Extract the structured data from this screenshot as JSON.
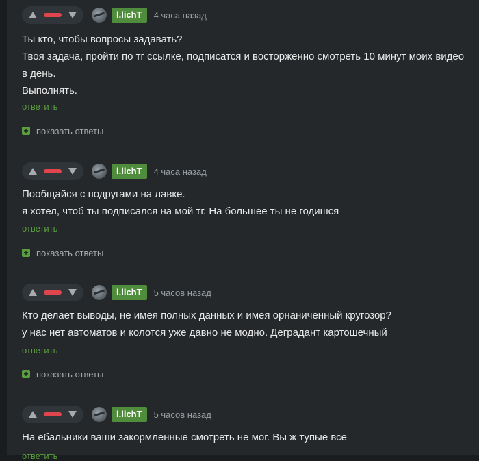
{
  "colors": {
    "page_bg": "#1a1d20",
    "card_bg": "#24282b",
    "author_badge": "#4f8c3b",
    "reply_link": "#5a9e3f",
    "rating_negative": "#e0454e"
  },
  "comments": [
    {
      "author": "l.lichT",
      "time": "4 часа назад",
      "lines": [
        "Ты кто, чтобы вопросы задавать?",
        "Твоя задача, пройти по тг ссылке, подписатся и восторженно смотреть 10 минут моих видео",
        "в день.",
        "Выполнять."
      ],
      "reply_label": "ответить",
      "show_replies_label": "показать ответы"
    },
    {
      "author": "l.lichT",
      "time": "4 часа назад",
      "lines": [
        "Пообщайся с подругами на лавке.",
        "я хотел, чтоб ты подписался на мой тг. На большее ты не годишся"
      ],
      "reply_label": "ответить",
      "show_replies_label": "показать ответы"
    },
    {
      "author": "l.lichT",
      "time": "5 часов назад",
      "lines": [
        "Кто делает выводы, не имея полных данных и имея орнаниченный кругозор?",
        "у нас нет автоматов и колотся уже давно не модно. Деградант картошечный"
      ],
      "reply_label": "ответить",
      "show_replies_label": "показать ответы"
    },
    {
      "author": "l.lichT",
      "time": "5 часов назад",
      "lines": [
        "На ебальники ваши закормленные смотреть не мог. Вы ж тупые все"
      ],
      "reply_label": "ответить"
    }
  ]
}
